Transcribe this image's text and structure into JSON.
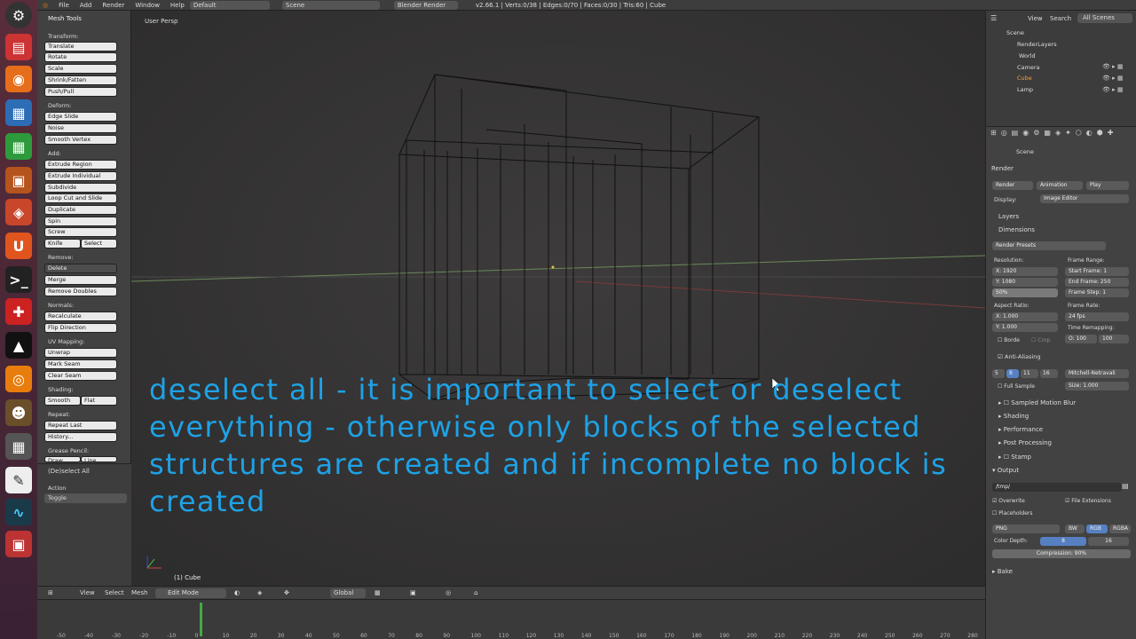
{
  "topbar": {
    "menus": [
      "File",
      "Add",
      "Render",
      "Window",
      "Help"
    ],
    "layout": "Default",
    "scene": "Scene",
    "engine": "Blender Render",
    "stats": "v2.66.1 | Verts:0/38 | Edges:0/70 | Faces:0/30 | Tris:60 | Cube"
  },
  "toolshelf": {
    "title": "Mesh Tools",
    "transform": {
      "label": "Transform:",
      "items": [
        "Translate",
        "Rotate",
        "Scale",
        "Shrink/Fatten",
        "Push/Pull"
      ]
    },
    "deform": {
      "label": "Deform:",
      "items": [
        "Edge Slide",
        "Noise",
        "Smooth Vertex"
      ]
    },
    "add": {
      "label": "Add:",
      "items": [
        "Extrude Region",
        "Extrude Individual",
        "Subdivide",
        "Loop Cut and Slide",
        "Duplicate",
        "Spin",
        "Screw"
      ],
      "knife": "Knife",
      "select": "Select"
    },
    "remove": {
      "label": "Remove:",
      "delete": "Delete",
      "items": [
        "Merge",
        "Remove Doubles"
      ]
    },
    "normals": {
      "label": "Normals:",
      "items": [
        "Recalculate",
        "Flip Direction"
      ]
    },
    "uv": {
      "label": "UV Mapping:",
      "items": [
        "Unwrap",
        "Mark Seam",
        "Clear Seam"
      ]
    },
    "shading": {
      "label": "Shading:",
      "smooth": "Smooth",
      "flat": "Flat"
    },
    "repeat": {
      "label": "Repeat:",
      "items": [
        "Repeat Last",
        "History..."
      ]
    },
    "grease": {
      "label": "Grease Pencil:",
      "draw": "Draw",
      "line": "Line"
    },
    "operator": {
      "title": "(De)select All",
      "action_label": "Action",
      "action_value": "Toggle"
    }
  },
  "viewport": {
    "label": "User Persp",
    "object": "(1) Cube",
    "caption": "deselect all - it is important to select or deselect everything - otherwise only blocks of the selected structures are created and if incomplete no block is created"
  },
  "header": {
    "menus": [
      "View",
      "Select",
      "Mesh"
    ],
    "mode": "Edit Mode",
    "orientation": "Global"
  },
  "timeline": {
    "ticks": [
      "-50",
      "-40",
      "-30",
      "-20",
      "-10",
      "0",
      "10",
      "20",
      "30",
      "40",
      "50",
      "60",
      "70",
      "80",
      "90",
      "100",
      "110",
      "120",
      "130",
      "140",
      "150",
      "160",
      "170",
      "180",
      "190",
      "200",
      "210",
      "220",
      "230",
      "240",
      "250",
      "260",
      "270",
      "280"
    ]
  },
  "outliner": {
    "menus": [
      "View",
      "Search"
    ],
    "filter": "All Scenes",
    "items": [
      "Scene",
      "RenderLayers",
      "World",
      "Camera",
      "Cube",
      "Lamp"
    ]
  },
  "properties": {
    "scene": "Scene",
    "render": "Render",
    "render_btn": "Render",
    "animation_btn": "Animation",
    "play_btn": "Play",
    "display_label": "Display:",
    "display_value": "Image Editor",
    "layers": "Layers",
    "dimensions": "Dimensions",
    "presets": "Render Presets",
    "resolution_label": "Resolution:",
    "res_x": "X: 1920",
    "res_y": "Y: 1080",
    "res_pct": "50%",
    "frame_range_label": "Frame Range:",
    "start": "Start Frame: 1",
    "end": "End Frame: 250",
    "step": "Frame Step: 1",
    "aspect_label": "Aspect Ratio:",
    "asp_x": "X: 1.000",
    "asp_y": "Y: 1.000",
    "frame_rate_label": "Frame Rate:",
    "fps": "24 fps",
    "time_remap": "Time Remapping:",
    "old": "O: 100",
    "new": "100",
    "border": "Borde",
    "crop": "Crop",
    "aa": "Anti-Aliasing",
    "aa_samples": [
      "5",
      "8",
      "11",
      "16"
    ],
    "filter": "Mitchell-Netravali",
    "full_sample": "Full Sample",
    "size": "Size: 1.000",
    "motion_blur": "Sampled Motion Blur",
    "shading": "Shading",
    "performance": "Performance",
    "post": "Post Processing",
    "stamp": "Stamp",
    "output": "Output",
    "path": "/tmp/",
    "overwrite": "Overwrite",
    "file_ext": "File Extensions",
    "placeholders": "Placeholders",
    "format": "PNG",
    "bw": "BW",
    "rgb": "RGB",
    "rgba": "RGBA",
    "depth_label": "Color Depth:",
    "depth8": "8",
    "depth16": "16",
    "compression": "Compression: 90%",
    "bake": "Bake"
  }
}
